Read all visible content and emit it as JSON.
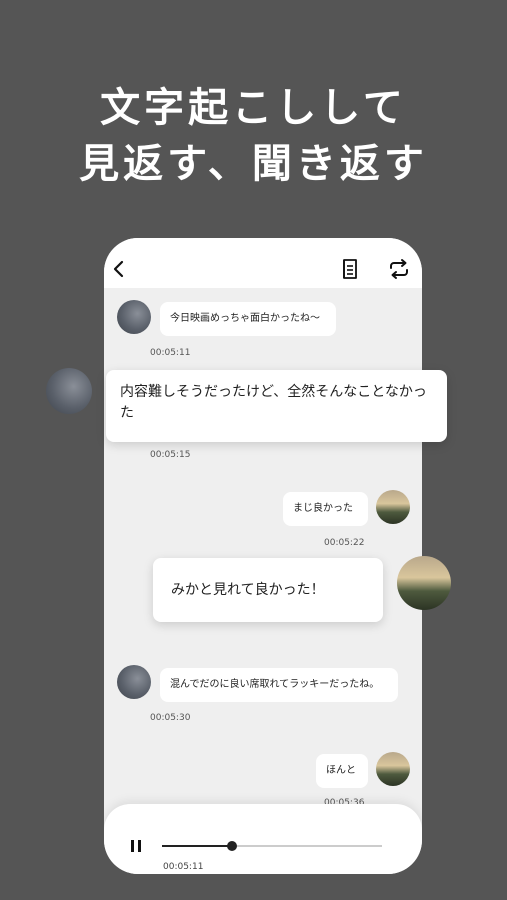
{
  "headline": {
    "line1": "文字起こしして",
    "line2": "見返す、聞き返す"
  },
  "header": {
    "back_icon": "chevron-left-icon",
    "doc_icon": "document-icon",
    "repeat_icon": "repeat-icon"
  },
  "messages": [
    {
      "side": "left",
      "text": "今日映画めっちゃ面白かったね〜",
      "time": "00:05:11"
    },
    {
      "side": "left",
      "text": "内容難しそうだったけど、全然そんなことなかった",
      "time": "00:05:15"
    },
    {
      "side": "right",
      "text": "まじ良かった",
      "time": "00:05:22"
    },
    {
      "side": "right",
      "text": "みかと見れて良かった！"
    },
    {
      "side": "left",
      "text": "混んでだのに良い席取れてラッキーだったね。",
      "time": "00:05:30"
    },
    {
      "side": "right",
      "text": "ほんと",
      "time": "00:05:36"
    }
  ],
  "player": {
    "time": "00:05:11",
    "progress": 0.32,
    "pause_icon": "pause-icon"
  },
  "colors": {
    "background": "#555555",
    "phone_bg": "#efefef",
    "bubble": "#ffffff",
    "text": "#222222"
  }
}
